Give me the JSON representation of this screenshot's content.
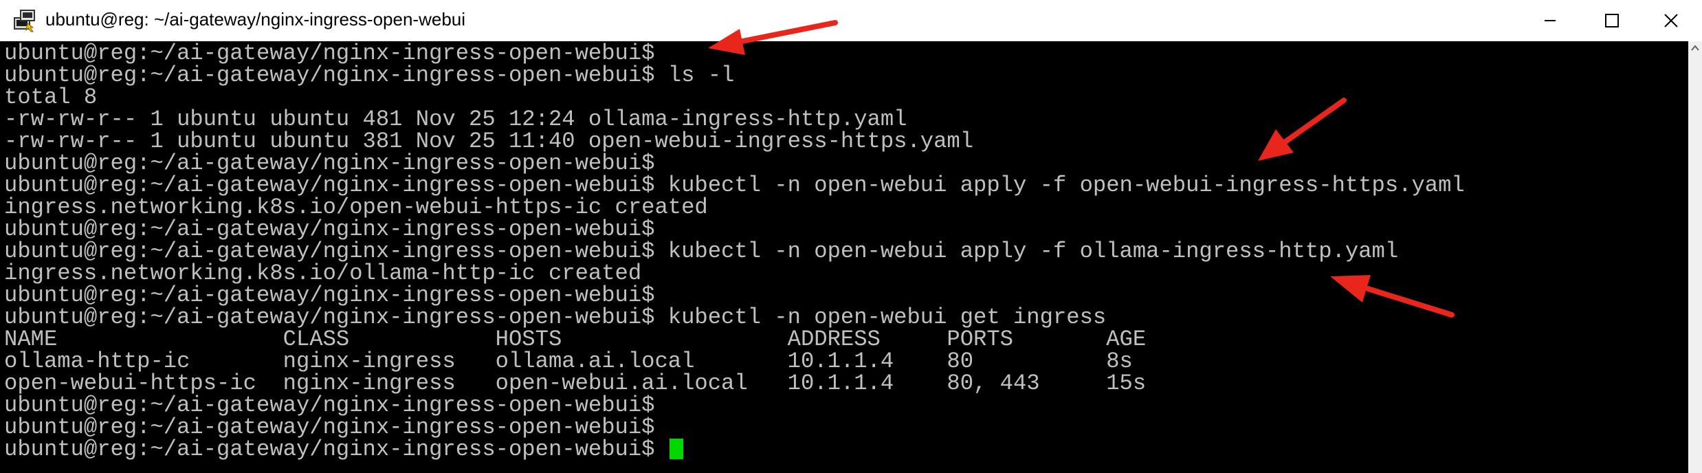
{
  "window": {
    "title": "ubuntu@reg: ~/ai-gateway/nginx-ingress-open-webui",
    "app_icon": "putty-terminal-icon",
    "controls": {
      "minimize_icon": "minimize-icon",
      "maximize_icon": "maximize-icon",
      "close_icon": "close-icon"
    }
  },
  "terminal": {
    "lines": [
      {
        "prompt": "ubuntu@reg:~/ai-gateway/nginx-ingress-open-webui$",
        "command": ""
      },
      {
        "prompt": "ubuntu@reg:~/ai-gateway/nginx-ingress-open-webui$",
        "command": " ls -l"
      },
      {
        "prompt": "",
        "command": "total 8"
      },
      {
        "prompt": "",
        "command": "-rw-rw-r-- 1 ubuntu ubuntu 481 Nov 25 12:24 ollama-ingress-http.yaml"
      },
      {
        "prompt": "",
        "command": "-rw-rw-r-- 1 ubuntu ubuntu 381 Nov 25 11:40 open-webui-ingress-https.yaml"
      },
      {
        "prompt": "ubuntu@reg:~/ai-gateway/nginx-ingress-open-webui$",
        "command": ""
      },
      {
        "prompt": "ubuntu@reg:~/ai-gateway/nginx-ingress-open-webui$",
        "command": " kubectl -n open-webui apply -f open-webui-ingress-https.yaml"
      },
      {
        "prompt": "",
        "command": "ingress.networking.k8s.io/open-webui-https-ic created"
      },
      {
        "prompt": "ubuntu@reg:~/ai-gateway/nginx-ingress-open-webui$",
        "command": ""
      },
      {
        "prompt": "ubuntu@reg:~/ai-gateway/nginx-ingress-open-webui$",
        "command": " kubectl -n open-webui apply -f ollama-ingress-http.yaml"
      },
      {
        "prompt": "",
        "command": "ingress.networking.k8s.io/ollama-http-ic created"
      },
      {
        "prompt": "ubuntu@reg:~/ai-gateway/nginx-ingress-open-webui$",
        "command": ""
      },
      {
        "prompt": "ubuntu@reg:~/ai-gateway/nginx-ingress-open-webui$",
        "command": " kubectl -n open-webui get ingress"
      },
      {
        "prompt": "",
        "command": "NAME                 CLASS           HOSTS                 ADDRESS     PORTS       AGE"
      },
      {
        "prompt": "",
        "command": "ollama-http-ic       nginx-ingress   ollama.ai.local       10.1.1.4    80          8s"
      },
      {
        "prompt": "",
        "command": "open-webui-https-ic  nginx-ingress   open-webui.ai.local   10.1.1.4    80, 443     15s"
      },
      {
        "prompt": "ubuntu@reg:~/ai-gateway/nginx-ingress-open-webui$",
        "command": ""
      },
      {
        "prompt": "ubuntu@reg:~/ai-gateway/nginx-ingress-open-webui$",
        "command": ""
      },
      {
        "prompt": "ubuntu@reg:~/ai-gateway/nginx-ingress-open-webui$",
        "command": " ",
        "cursor": true
      }
    ],
    "colors": {
      "background": "#000000",
      "foreground": "#c0c0c0",
      "cursor": "#00d800",
      "annotation_arrow": "#e8261c"
    }
  },
  "annotations": {
    "arrow_icon": "red-arrow-icon",
    "count": 4
  }
}
